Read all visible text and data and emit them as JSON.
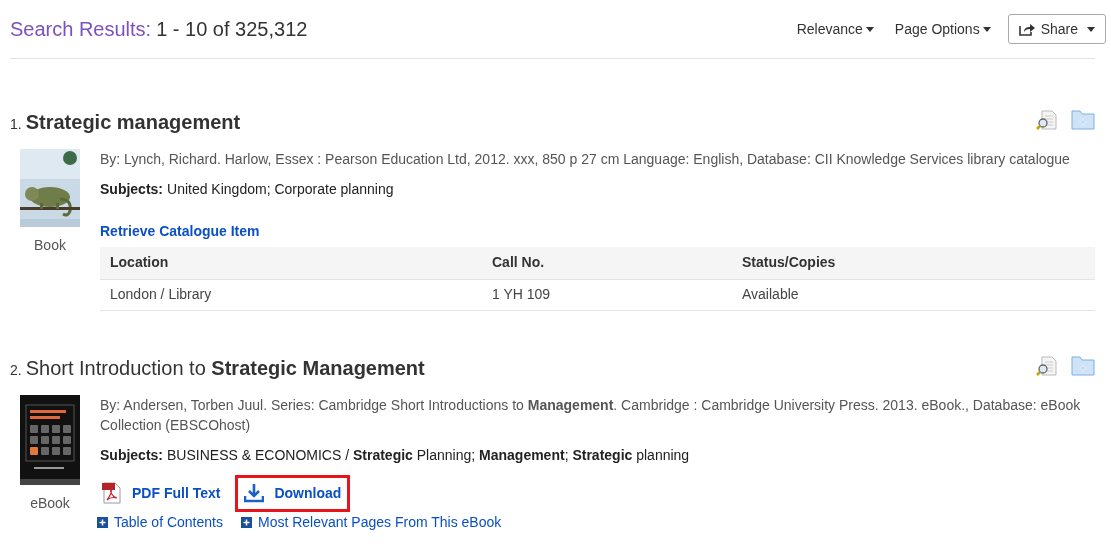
{
  "header": {
    "label": "Search Results:",
    "range": "1 - 10 of 325,312",
    "sort": "Relevance",
    "page_options": "Page Options",
    "share": "Share"
  },
  "results": [
    {
      "number": "1.",
      "title": "**Strategic management**",
      "cover": {
        "kind": "picture"
      },
      "format": "Book",
      "byline": "By: Lynch, Richard. Harlow, Essex : Pearson Education Ltd, 2012. xxx, 850 p 27 cm Language: English, Database: CII Knowledge Services library catalogue",
      "subjects_label": "Subjects:",
      "subjects": "United Kingdom; Corporate planning",
      "catalogue_link": "Retrieve Catalogue Item",
      "holdings": {
        "columns": [
          "Location",
          "Call No.",
          "Status/Copies"
        ],
        "rows": [
          [
            "London / Library",
            "1 YH 109",
            "Available"
          ]
        ]
      }
    },
    {
      "number": "2.",
      "title": "Short Introduction to **Strategic Management**",
      "cover": {
        "kind": "picture"
      },
      "format": "eBook",
      "byline": "By: Andersen, Torben Juul. Series: Cambridge Short Introductions to **Management**. Cambridge : Cambridge University Press. 2013. eBook., Database: eBook Collection (EBSCOhost)",
      "subjects_label": "Subjects:",
      "subjects": "BUSINESS & ECONOMICS / **Strategic** Planning; **Management**; **Strategic** planning",
      "actions": [
        {
          "kind": "pdf",
          "label": "PDF Full Text",
          "highlighted": false
        },
        {
          "kind": "download",
          "label": "Download",
          "highlighted": true
        }
      ],
      "expanders": [
        "Table of Contents",
        "Most Relevant Pages From This eBook"
      ]
    }
  ]
}
